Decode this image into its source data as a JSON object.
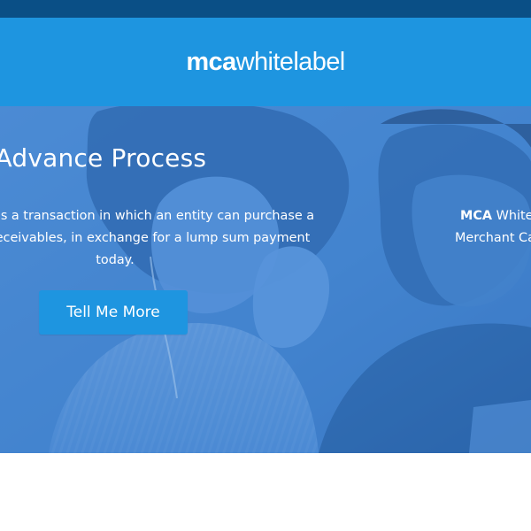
{
  "brand": {
    "name_bold": "mca",
    "name_regular": "whitelabel",
    "colors": {
      "top_strip": "#0a4f86",
      "header": "#1e95e0",
      "hero_overlay": "#3f86d0",
      "cta": "#1e95e0"
    }
  },
  "hero": {
    "title": "ant Cash Advance Process",
    "text_lines": [
      "ance (MCA), is a transaction in which an entity can purchase a",
      "nt’s future receivables, in exchange for a lump sum payment",
      "today."
    ],
    "cta_label": "Tell Me More",
    "next_slide": {
      "line1_bold": "MCA",
      "line1_rest": " White",
      "line2": "Merchant Ca"
    }
  }
}
